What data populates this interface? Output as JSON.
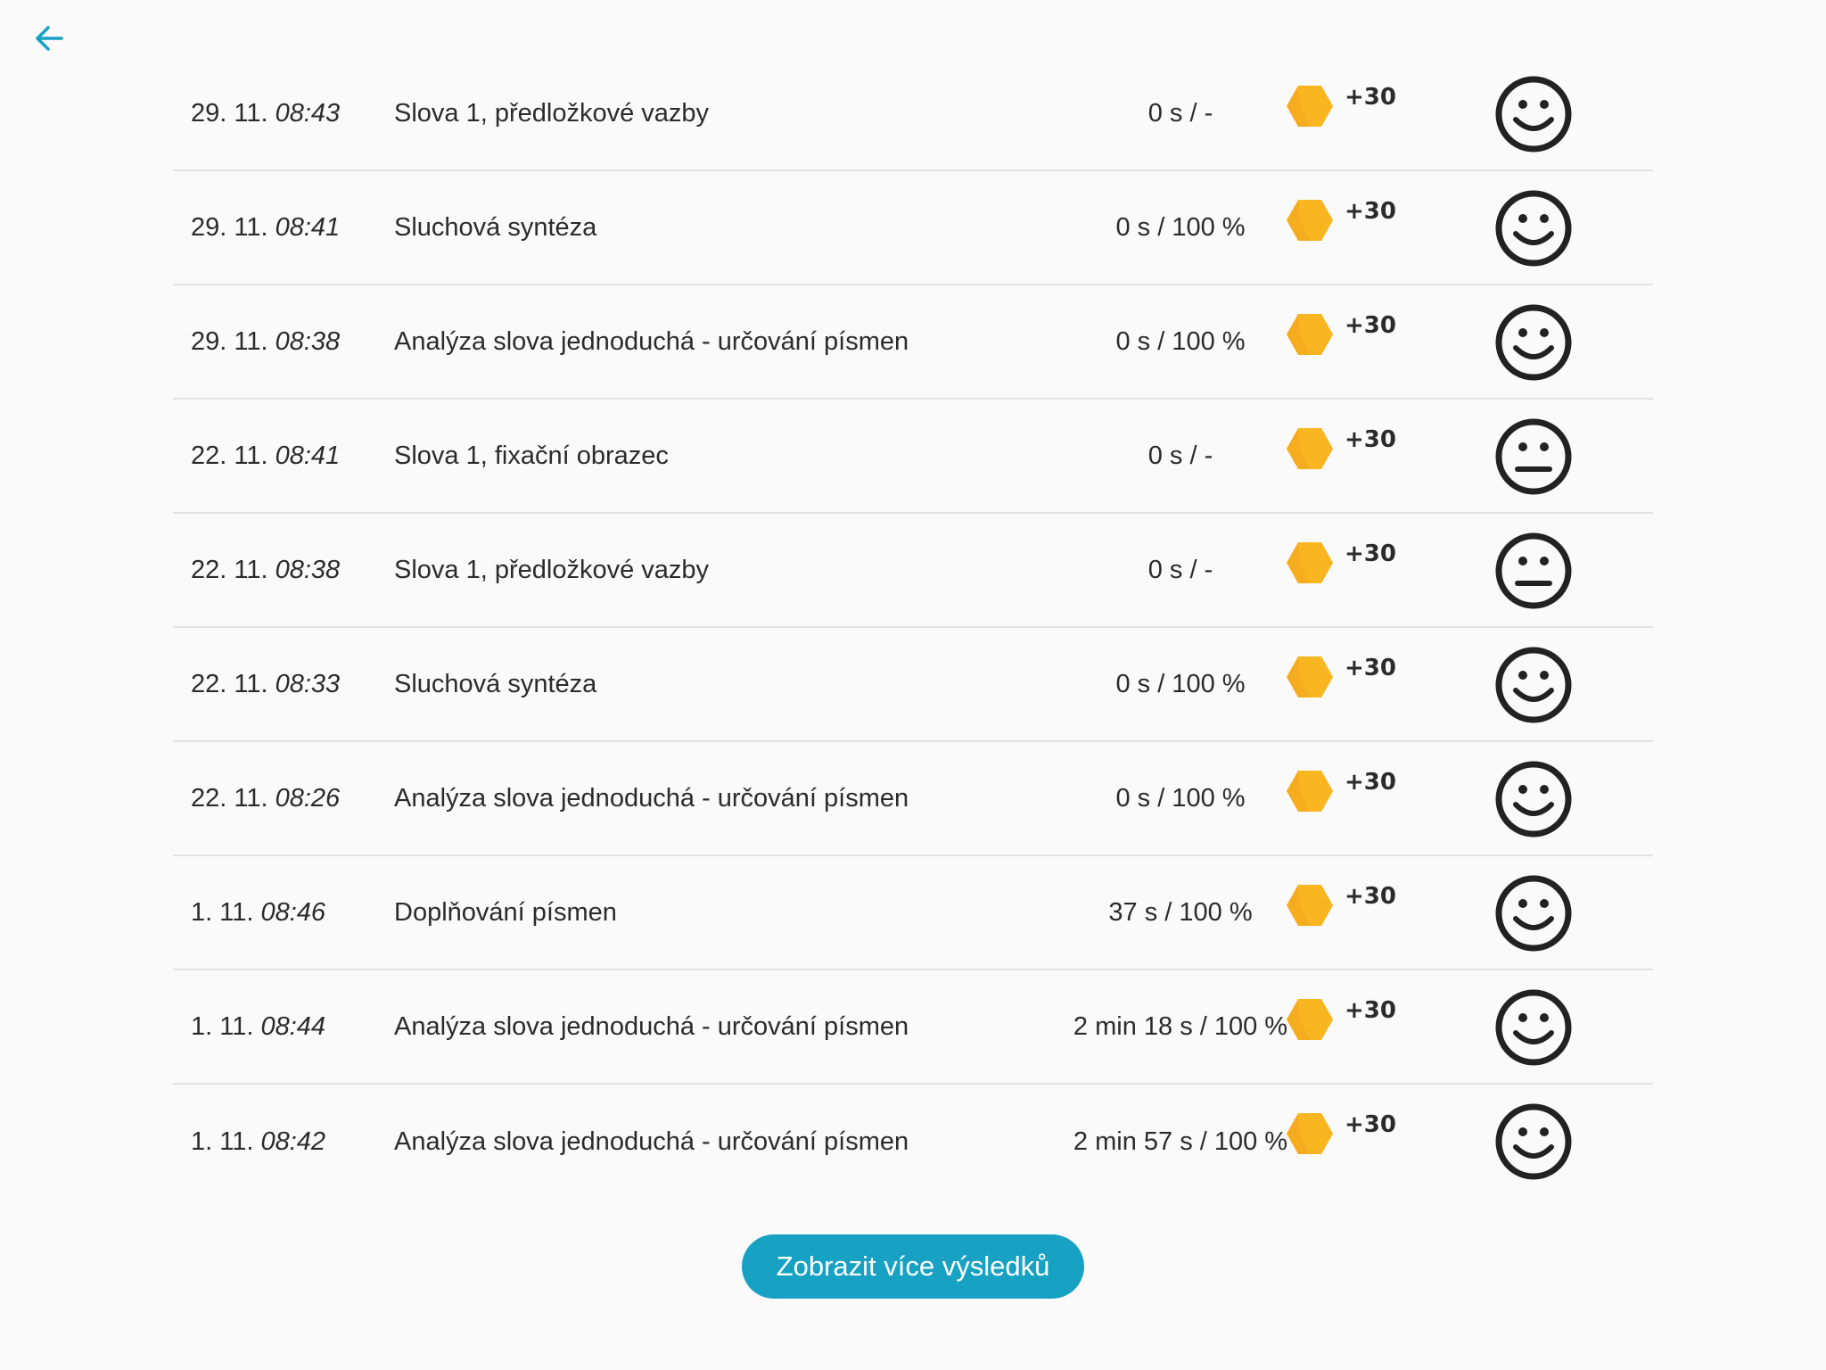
{
  "header": {
    "back_icon": "arrow-left-icon",
    "accent_color": "#17a2c4"
  },
  "results": [
    {
      "date": "29. 11.",
      "time": "08:43",
      "name": "Slova 1, předložkové vazby",
      "score": "0 s / -",
      "points": "+30",
      "mood": "happy"
    },
    {
      "date": "29. 11.",
      "time": "08:41",
      "name": "Sluchová syntéza",
      "score": "0 s / 100 %",
      "points": "+30",
      "mood": "happy"
    },
    {
      "date": "29. 11.",
      "time": "08:38",
      "name": "Analýza slova jednoduchá - určování písmen",
      "score": "0 s / 100 %",
      "points": "+30",
      "mood": "happy"
    },
    {
      "date": "22. 11.",
      "time": "08:41",
      "name": "Slova 1, fixační obrazec",
      "score": "0 s / -",
      "points": "+30",
      "mood": "neutral"
    },
    {
      "date": "22. 11.",
      "time": "08:38",
      "name": "Slova 1, předložkové vazby",
      "score": "0 s / -",
      "points": "+30",
      "mood": "neutral"
    },
    {
      "date": "22. 11.",
      "time": "08:33",
      "name": "Sluchová syntéza",
      "score": "0 s / 100 %",
      "points": "+30",
      "mood": "happy"
    },
    {
      "date": "22. 11.",
      "time": "08:26",
      "name": "Analýza slova jednoduchá - určování písmen",
      "score": "0 s / 100 %",
      "points": "+30",
      "mood": "happy"
    },
    {
      "date": "1. 11.",
      "time": "08:46",
      "name": "Doplňování písmen",
      "score": "37 s / 100 %",
      "points": "+30",
      "mood": "happy"
    },
    {
      "date": "1. 11.",
      "time": "08:44",
      "name": "Analýza slova jednoduchá - určování písmen",
      "score": "2 min 18 s / 100 %",
      "points": "+30",
      "mood": "happy"
    },
    {
      "date": "1. 11.",
      "time": "08:42",
      "name": "Analýza slova jednoduchá - určování písmen",
      "score": "2 min 57 s / 100 %",
      "points": "+30",
      "mood": "happy"
    }
  ],
  "reward_icon": "coin-hexagon-icon",
  "reward_color": "#f5ac1e",
  "more_button_label": "Zobrazit více výsledků"
}
